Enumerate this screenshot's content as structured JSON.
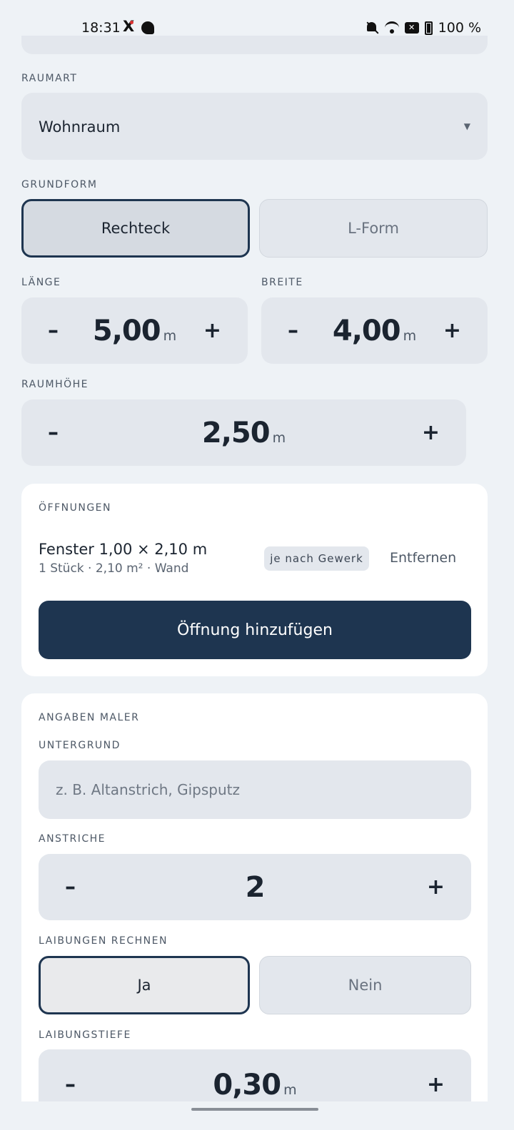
{
  "status_bar": {
    "time": "18:31",
    "battery": "100 %",
    "icons": [
      "x-app-icon",
      "app-icon",
      "bell-off-icon",
      "wifi-icon",
      "no-sim-icon",
      "battery-icon"
    ]
  },
  "room_type": {
    "label": "RAUMART",
    "value": "Wohnraum"
  },
  "base_shape": {
    "label": "GRUNDFORM",
    "options": [
      "Rechteck",
      "L-Form"
    ],
    "selected": "Rechteck"
  },
  "length": {
    "label": "LÄNGE",
    "value": "5,00",
    "unit": "m"
  },
  "width": {
    "label": "BREITE",
    "value": "4,00",
    "unit": "m"
  },
  "room_height": {
    "label": "RAUMHÖHE",
    "value": "2,50",
    "unit": "m"
  },
  "openings": {
    "label": "ÖFFNUNGEN",
    "items": [
      {
        "title": "Fenster 1,00 × 2,10 m",
        "subtitle": "1 Stück · 2,10 m² · Wand",
        "badge": "je nach Gewerk",
        "remove_label": "Entfernen"
      }
    ],
    "add_label": "Öffnung hinzufügen"
  },
  "painter": {
    "section_label": "ANGABEN MALER",
    "substrate": {
      "label": "UNTERGRUND",
      "placeholder": "z. B. Altanstrich, Gipsputz"
    },
    "coats": {
      "label": "ANSTRICHE",
      "value": "2"
    },
    "reveals": {
      "label": "LAIBUNGEN RECHNEN",
      "options": [
        "Ja",
        "Nein"
      ],
      "selected": "Ja"
    },
    "reveal_depth": {
      "label": "LAIBUNGSTIEFE",
      "value": "0,30",
      "unit": "m"
    }
  },
  "colors": {
    "primary": "#1e3550",
    "background": "#eef2f6",
    "field": "#e3e7ed",
    "card": "#ffffff"
  }
}
